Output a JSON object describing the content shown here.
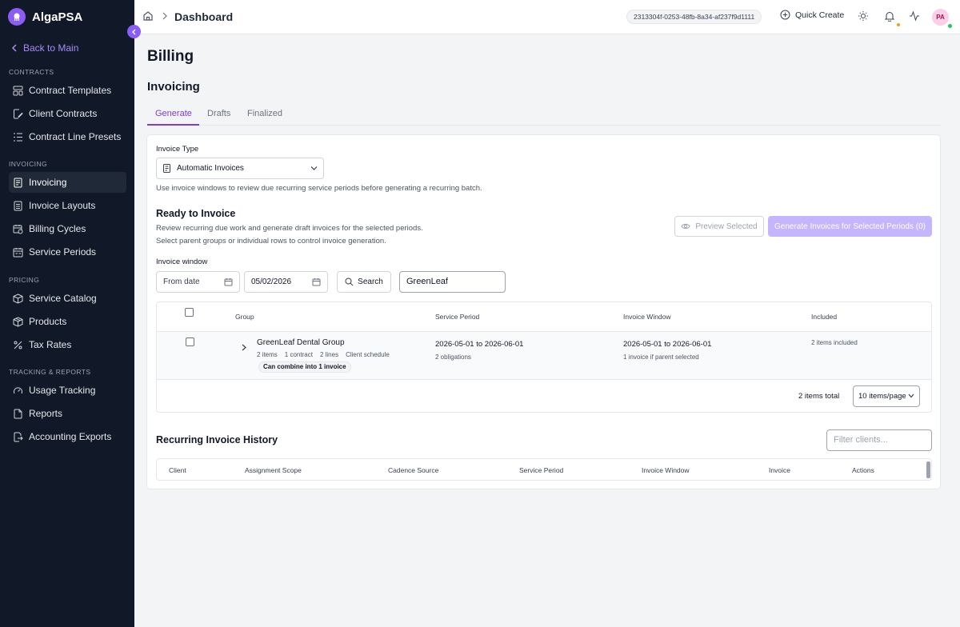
{
  "app": {
    "name": "AlgaPSA"
  },
  "sidebar": {
    "back_label": "Back to Main",
    "sections": {
      "contracts": "CONTRACTS",
      "invoicing": "INVOICING",
      "pricing": "PRICING",
      "tracking": "TRACKING & REPORTS"
    },
    "items": {
      "contract_templates": "Contract Templates",
      "client_contracts": "Client Contracts",
      "contract_line_presets": "Contract Line Presets",
      "invoicing": "Invoicing",
      "invoice_layouts": "Invoice Layouts",
      "billing_cycles": "Billing Cycles",
      "service_periods": "Service Periods",
      "service_catalog": "Service Catalog",
      "products": "Products",
      "tax_rates": "Tax Rates",
      "usage_tracking": "Usage Tracking",
      "reports": "Reports",
      "accounting_exports": "Accounting Exports"
    },
    "active_item": "Invoicing"
  },
  "header": {
    "breadcrumb_title": "Dashboard",
    "tenant_id": "2313304f-0253-48fb-8a34-af237f9d1111",
    "quick_create": "Quick Create",
    "avatar_initials": "PA"
  },
  "main": {
    "page_title": "Billing",
    "section_title": "Invoicing",
    "tabs": [
      "Generate",
      "Drafts",
      "Finalized"
    ],
    "active_tab": "Generate",
    "invoice_type": {
      "label": "Invoice Type",
      "value": "Automatic Invoices",
      "help": "Use invoice windows to review due recurring service periods before generating a recurring batch."
    },
    "ready": {
      "title": "Ready to Invoice",
      "desc1": "Review recurring due work and generate draft invoices for the selected periods.",
      "desc2": "Select parent groups or individual rows to control invoice generation.",
      "preview_button": "Preview Selected",
      "generate_button": "Generate Invoices for Selected Periods (0)"
    },
    "window": {
      "label": "Invoice window",
      "from_placeholder": "From date",
      "to_value": "05/02/2026",
      "search_button": "Search",
      "search_value": "GreenLeaf"
    },
    "table": {
      "columns": [
        "Group",
        "Service Period",
        "Invoice Window",
        "Included"
      ],
      "rows": [
        {
          "group": "GreenLeaf Dental Group",
          "meta": [
            "2 items",
            "1 contract",
            "2 lines",
            "Client schedule"
          ],
          "badge": "Can combine into 1 invoice",
          "service_period": "2026-05-01 to 2026-06-01",
          "service_period_sub": "2 obligations",
          "invoice_window": "2026-05-01 to 2026-06-01",
          "invoice_window_sub": "1 invoice if parent selected",
          "included": "2 items included"
        }
      ],
      "total": "2 items total",
      "page_size": "10 items/page"
    },
    "history": {
      "title": "Recurring Invoice History",
      "filter_placeholder": "Filter clients...",
      "columns": [
        "Client",
        "Assignment Scope",
        "Cadence Source",
        "Service Period",
        "Invoice Window",
        "Invoice",
        "Actions"
      ]
    }
  },
  "colors": {
    "accent": "#7c3aed",
    "sidebar_bg": "#111827",
    "primary_disabled": "#c4b5fd"
  }
}
